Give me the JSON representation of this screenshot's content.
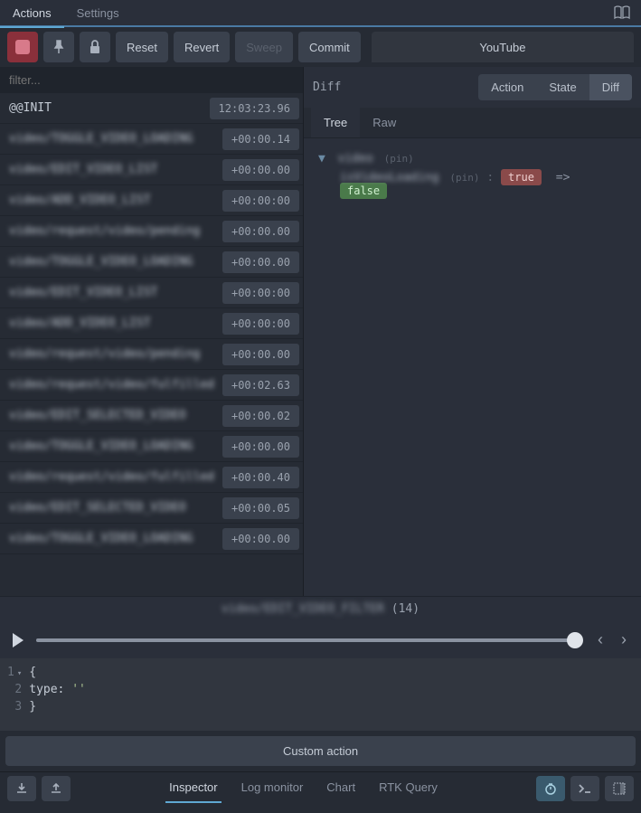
{
  "topTabs": {
    "actions": "Actions",
    "settings": "Settings"
  },
  "toolbar": {
    "reset": "Reset",
    "revert": "Revert",
    "sweep": "Sweep",
    "commit": "Commit",
    "instance": "YouTube"
  },
  "filter": {
    "placeholder": "filter..."
  },
  "actions": [
    {
      "name": "@@INIT",
      "time": "12:03:23.96",
      "blur": false
    },
    {
      "name": "video/TOGGLE_VIDEO_LOADING",
      "time": "+00:00.14",
      "blur": true
    },
    {
      "name": "video/EDIT_VIDEO_LIST",
      "time": "+00:00.00",
      "blur": true
    },
    {
      "name": "video/ADD_VIDEO_LIST",
      "time": "+00:00:00",
      "blur": true
    },
    {
      "name": "video/request/video/pending",
      "time": "+00:00.00",
      "blur": true
    },
    {
      "name": "video/TOGGLE_VIDEO_LOADING",
      "time": "+00:00.00",
      "blur": true
    },
    {
      "name": "video/EDIT_VIDEO_LIST",
      "time": "+00:00:00",
      "blur": true
    },
    {
      "name": "video/ADD_VIDEO_LIST",
      "time": "+00:00:00",
      "blur": true
    },
    {
      "name": "video/request/video/pending",
      "time": "+00:00.00",
      "blur": true
    },
    {
      "name": "video/request/video/fulfilled",
      "time": "+00:02.63",
      "blur": true
    },
    {
      "name": "video/EDIT_SELECTED_VIDEO",
      "time": "+00:00.02",
      "blur": true
    },
    {
      "name": "video/TOGGLE_VIDEO_LOADING",
      "time": "+00:00.00",
      "blur": true
    },
    {
      "name": "video/request/video/fulfilled",
      "time": "+00:00.40",
      "blur": true
    },
    {
      "name": "video/EDIT_SELECTED_VIDEO",
      "time": "+00:00.05",
      "blur": true
    },
    {
      "name": "video/TOGGLE_VIDEO_LOADING",
      "time": "+00:00.00",
      "blur": true
    }
  ],
  "rightPane": {
    "diffLabel": "Diff",
    "seg": {
      "action": "Action",
      "state": "State",
      "diff": "Diff"
    },
    "treeTabs": {
      "tree": "Tree",
      "raw": "Raw"
    },
    "tree": {
      "rootKey": "video",
      "rootPin": "(pin)",
      "childKey": "isVideoLoading",
      "childPin": "(pin)",
      "from": "true",
      "arrow": "=>",
      "to": "false"
    }
  },
  "playback": {
    "title": "video/EDIT_VIDEO_FILTER",
    "count": "(14)"
  },
  "editor": {
    "lines": [
      "1",
      "2",
      "3"
    ],
    "brace_open": "{",
    "type_line": "  type: ",
    "empty_str": "''",
    "brace_close": "}"
  },
  "customAction": "Custom action",
  "bottomTabs": {
    "inspector": "Inspector",
    "logmonitor": "Log monitor",
    "chart": "Chart",
    "rtk": "RTK Query"
  }
}
